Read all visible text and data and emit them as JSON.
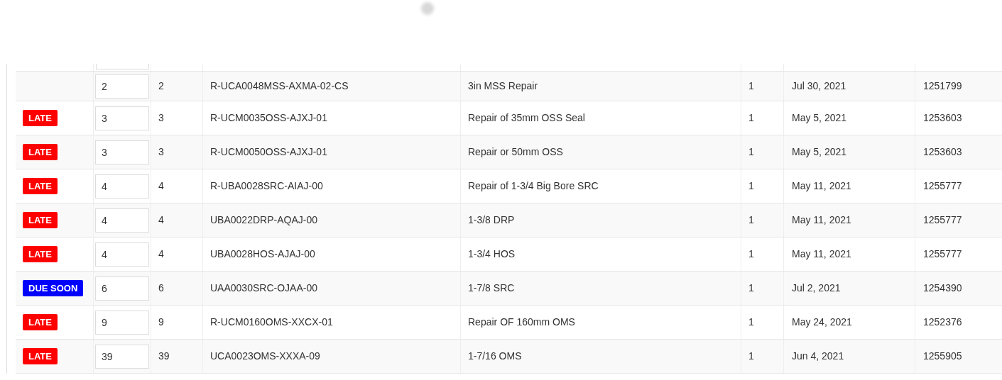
{
  "rows": [
    {
      "status": null,
      "input": "2",
      "qty": "2",
      "part": "R-UCA0048MSS-AXMA-02-CS",
      "description": "3in MSS Repair",
      "count": "1",
      "date": "Jul 30, 2021",
      "order": "1251799"
    },
    {
      "status": {
        "kind": "late",
        "label": "LATE"
      },
      "input": "3",
      "qty": "3",
      "part": "R-UCM0035OSS-AJXJ-01",
      "description": "Repair of 35mm OSS Seal",
      "count": "1",
      "date": "May 5, 2021",
      "order": "1253603"
    },
    {
      "status": {
        "kind": "late",
        "label": "LATE"
      },
      "input": "3",
      "qty": "3",
      "part": "R-UCM0050OSS-AJXJ-01",
      "description": "Repair or 50mm OSS",
      "count": "1",
      "date": "May 5, 2021",
      "order": "1253603"
    },
    {
      "status": {
        "kind": "late",
        "label": "LATE"
      },
      "input": "4",
      "qty": "4",
      "part": "R-UBA0028SRC-AIAJ-00",
      "description": "Repair of 1-3/4 Big Bore SRC",
      "count": "1",
      "date": "May 11, 2021",
      "order": "1255777"
    },
    {
      "status": {
        "kind": "late",
        "label": "LATE"
      },
      "input": "4",
      "qty": "4",
      "part": "UBA0022DRP-AQAJ-00",
      "description": "1-3/8 DRP",
      "count": "1",
      "date": "May 11, 2021",
      "order": "1255777"
    },
    {
      "status": {
        "kind": "late",
        "label": "LATE"
      },
      "input": "4",
      "qty": "4",
      "part": "UBA0028HOS-AJAJ-00",
      "description": "1-3/4 HOS",
      "count": "1",
      "date": "May 11, 2021",
      "order": "1255777"
    },
    {
      "status": {
        "kind": "due_soon",
        "label": "DUE SOON"
      },
      "input": "6",
      "qty": "6",
      "part": "UAA0030SRC-OJAA-00",
      "description": "1-7/8 SRC",
      "count": "1",
      "date": "Jul 2, 2021",
      "order": "1254390"
    },
    {
      "status": {
        "kind": "late",
        "label": "LATE"
      },
      "input": "9",
      "qty": "9",
      "part": "R-UCM0160OMS-XXCX-01",
      "description": "Repair OF 160mm OMS",
      "count": "1",
      "date": "May 24, 2021",
      "order": "1252376"
    },
    {
      "status": {
        "kind": "late",
        "label": "LATE"
      },
      "input": "39",
      "qty": "39",
      "part": "UCA0023OMS-XXXA-09",
      "description": "1-7/16 OMS",
      "count": "1",
      "date": "Jun 4, 2021",
      "order": "1255905"
    }
  ]
}
